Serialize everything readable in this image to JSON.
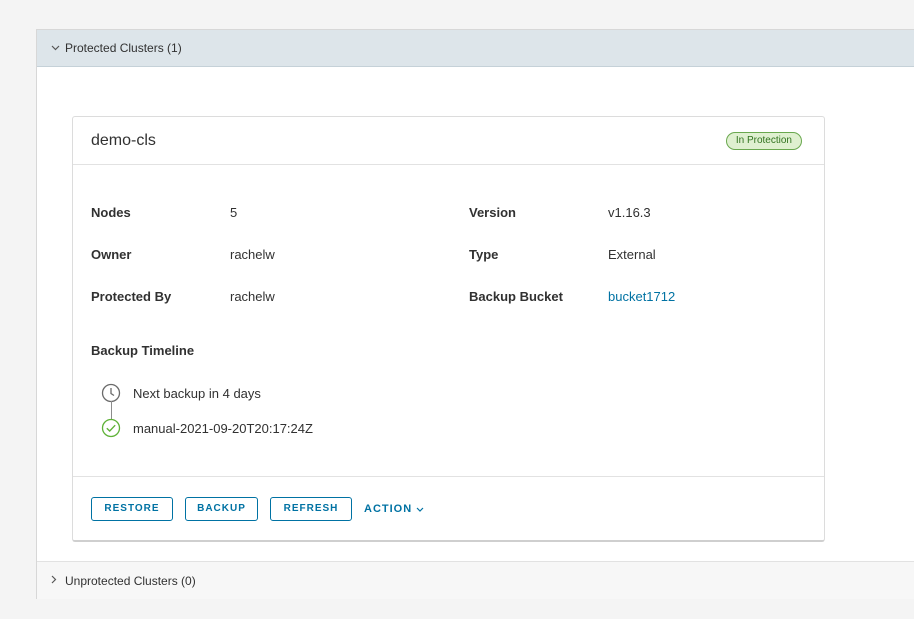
{
  "protected_section": {
    "label": "Protected Clusters (1)",
    "chevron": "chevron-down-icon"
  },
  "cluster": {
    "name": "demo-cls",
    "status": "In Protection",
    "fields": {
      "nodes_label": "Nodes",
      "nodes_value": "5",
      "owner_label": "Owner",
      "owner_value": "rachelw",
      "protected_by_label": "Protected By",
      "protected_by_value": "rachelw",
      "version_label": "Version",
      "version_value": "v1.16.3",
      "type_label": "Type",
      "type_value": "External",
      "bucket_label": "Backup Bucket",
      "bucket_value": "bucket1712"
    },
    "timeline": {
      "title": "Backup Timeline",
      "next": "Next backup in 4 days",
      "last": "manual-2021-09-20T20:17:24Z"
    },
    "actions": {
      "restore": "RESTORE",
      "backup": "BACKUP",
      "refresh": "REFRESH",
      "action": "ACTION"
    }
  },
  "unprotected_section": {
    "label": "Unprotected Clusters (0)",
    "chevron": "chevron-right-icon"
  },
  "colors": {
    "accent": "#0072a3",
    "success": "#6aa84f",
    "header_bg": "#dde5ea"
  }
}
